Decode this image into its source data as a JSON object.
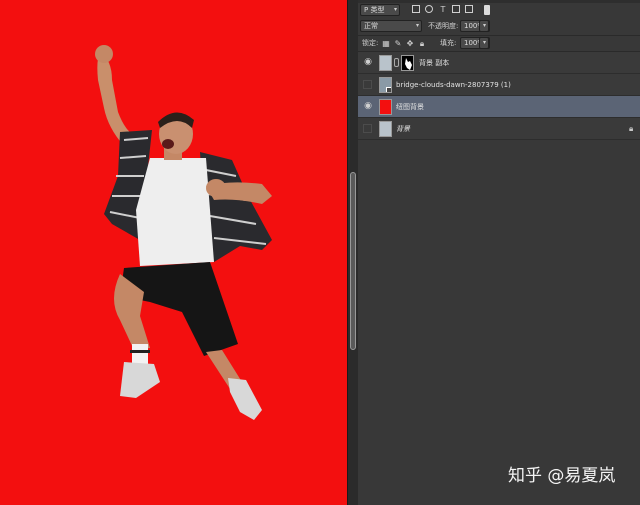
{
  "filter": {
    "kind_label": "P 类型",
    "icons": [
      "image-filter-icon",
      "adjustment-filter-icon",
      "type-filter-icon",
      "shape-filter-icon",
      "smart-object-filter-icon"
    ]
  },
  "blend": {
    "mode": "正常",
    "opacity_label": "不透明度:",
    "opacity_value": "100%"
  },
  "lock": {
    "label": "锁定:",
    "fill_label": "填充:",
    "fill_value": "100%"
  },
  "layers": [
    {
      "name": "背景 副本",
      "visible": true,
      "selected": false,
      "italic": false,
      "has_mask": true,
      "locked": false
    },
    {
      "name": "bridge-clouds-dawn-2807379 (1)",
      "visible": false,
      "selected": false,
      "italic": false,
      "has_mask": false,
      "locked": false
    },
    {
      "name": "纽图背景",
      "visible": true,
      "selected": true,
      "italic": false,
      "has_mask": false,
      "locked": false
    },
    {
      "name": "背景",
      "visible": false,
      "selected": false,
      "italic": true,
      "has_mask": false,
      "locked": true
    }
  ],
  "colors": {
    "canvas_background": "#f30f0f",
    "panel_background": "#383838",
    "selected_layer": "#5b6475"
  },
  "watermark": "知乎 @易夏岚"
}
